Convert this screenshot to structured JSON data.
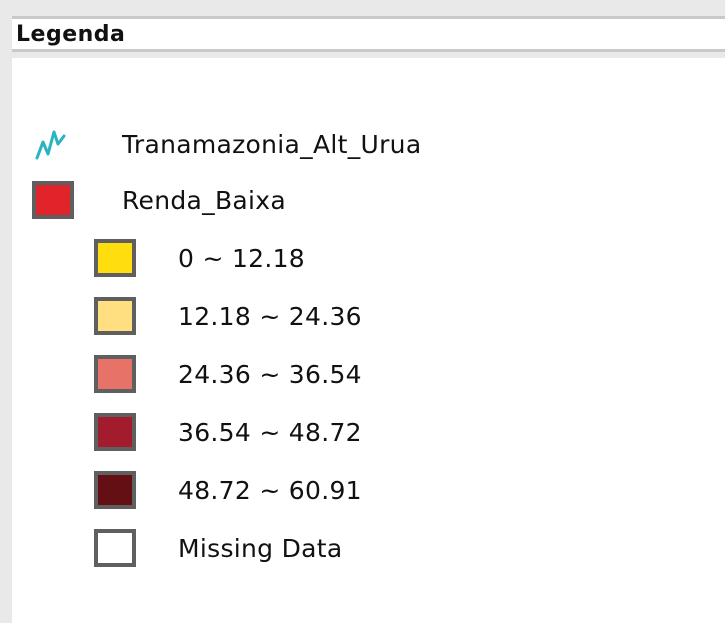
{
  "panel": {
    "title": "Legenda"
  },
  "layers": [
    {
      "name": "Tranamazonia_Alt_Urua",
      "icon": "polyline-layer-icon",
      "color": "#2ab3c0"
    },
    {
      "name": "Renda_Baixa",
      "icon": "polygon-layer-icon",
      "color": "#e1232a",
      "classes": [
        {
          "label": "0 ~ 12.18",
          "color": "#ffdd0f"
        },
        {
          "label": "12.18 ~ 24.36",
          "color": "#ffdf80"
        },
        {
          "label": "24.36 ~ 36.54",
          "color": "#e77368"
        },
        {
          "label": "36.54 ~ 48.72",
          "color": "#a21c2e"
        },
        {
          "label": "48.72 ~ 60.91",
          "color": "#630f14"
        },
        {
          "label": "Missing Data",
          "color": "#ffffff"
        }
      ]
    }
  ]
}
